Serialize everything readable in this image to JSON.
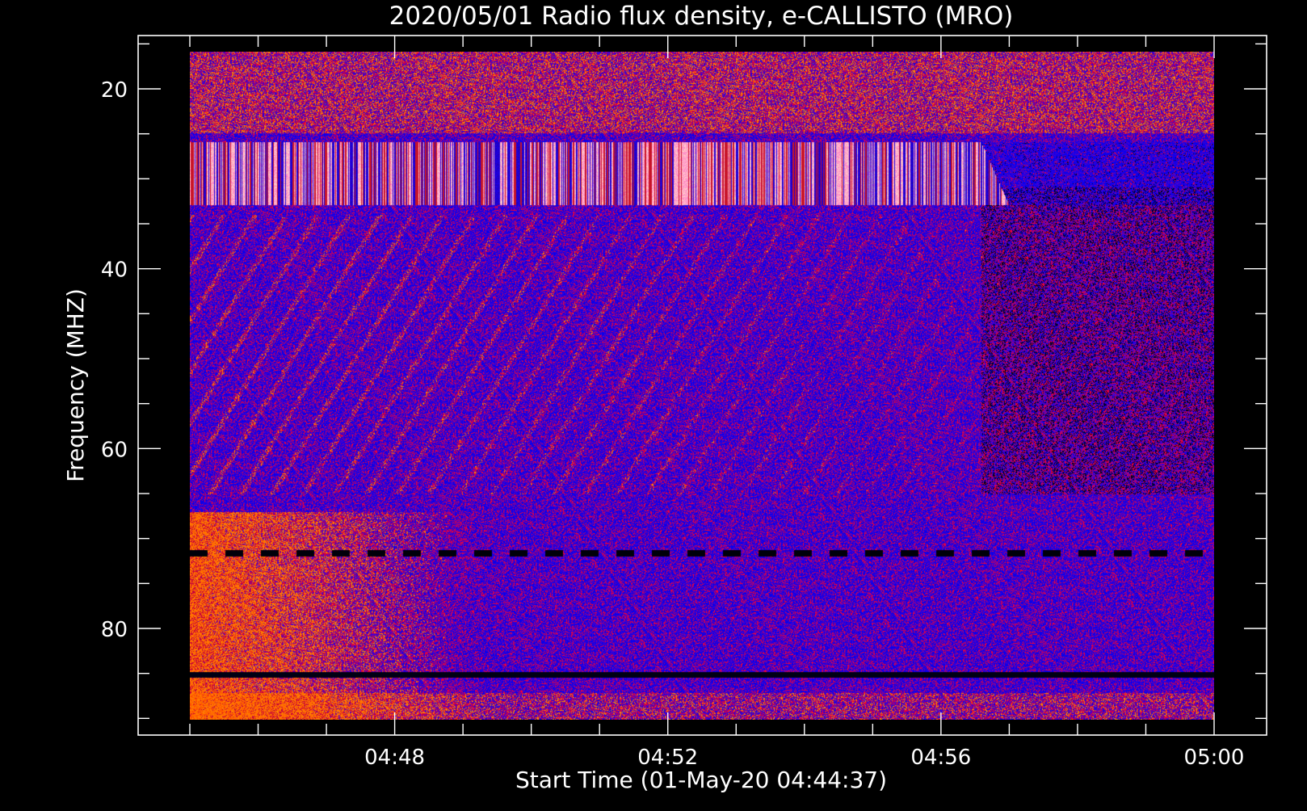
{
  "chart_data": {
    "type": "heatmap",
    "title": "2020/05/01  Radio flux density, e-CALLISTO (MRO)",
    "xlabel": "Start Time (01-May-20 04:44:37)",
    "ylabel": "Frequency (MHZ)",
    "x_range": [
      "04:44:37",
      "05:00:00"
    ],
    "xlim": [
      "04:45:00",
      "05:01:00"
    ],
    "ylim": [
      90,
      20
    ],
    "y_data_range": [
      15,
      89
    ],
    "y_inverted": true,
    "x_major_ticks": [
      "04:48",
      "04:52",
      "04:56",
      "05:00"
    ],
    "x_minor_ticks": [
      "04:45",
      "04:46",
      "04:47",
      "04:49",
      "04:50",
      "04:51",
      "04:53",
      "04:54",
      "04:55",
      "04:57",
      "04:58",
      "04:59"
    ],
    "y_major_ticks": [
      20,
      40,
      60,
      80
    ],
    "y_minor_ticks": [
      15,
      25,
      30,
      35,
      45,
      50,
      55,
      65,
      70,
      75,
      85,
      90
    ],
    "colors": {
      "background": "#000000",
      "low": "#0000ff",
      "mid": "#3a00c8",
      "high": "#ff2800",
      "dark": "#000020"
    },
    "features": [
      {
        "name": "striped interference band",
        "freq_range": [
          25,
          32
        ],
        "time_range": [
          "04:44:37",
          "04:56:30"
        ]
      },
      {
        "name": "persistent dark line",
        "freq": 70.5
      },
      {
        "name": "persistent dark line",
        "freq": 84
      }
    ]
  }
}
